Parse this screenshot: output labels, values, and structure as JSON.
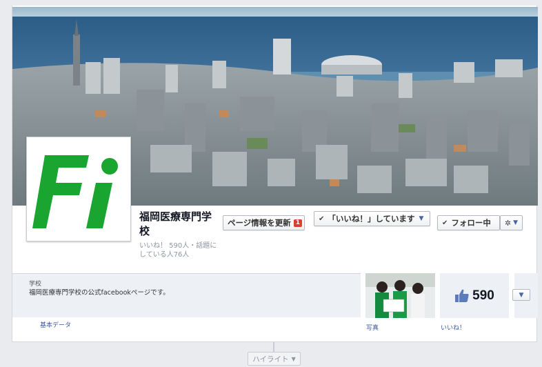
{
  "page": {
    "name": "福岡医療専門学校",
    "meta": "いいね！ 590人・話題にしている人76人",
    "logo_text": "Fi"
  },
  "colors": {
    "brand_green": "#1aa531",
    "fb_blue": "#3b5998",
    "badge_red": "#e03c31"
  },
  "actions": {
    "update_label": "ページ情報を更新",
    "update_badge": "1",
    "liked_label": "「いいね！」しています",
    "follow_label": "フォロー中",
    "gear_icon": "gear-icon"
  },
  "about": {
    "category": "学校",
    "description": "福岡医療専門学校の公式facebookページです。",
    "label": "基本データ"
  },
  "apps": {
    "photos_label": "写真",
    "likes_count": "590",
    "likes_label": "いいね！"
  },
  "timeline": {
    "highlight_label": "ハイライト"
  }
}
